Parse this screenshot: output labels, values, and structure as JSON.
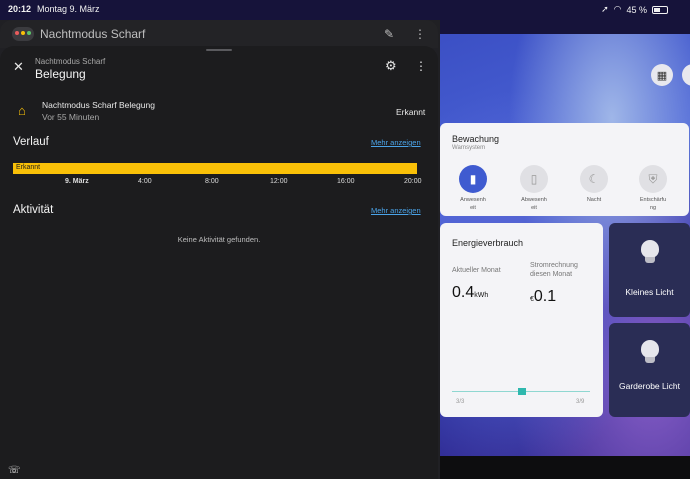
{
  "status": {
    "time": "20:12",
    "date": "Montag 9. März",
    "battery": "45 %"
  },
  "background_header": {
    "title": "Nachtmodus Scharf"
  },
  "dialog": {
    "subtitle": "Nachtmodus Scharf",
    "title": "Belegung",
    "entity": {
      "name": "Nachtmodus Scharf Belegung",
      "time": "Vor 55 Minuten",
      "state": "Erkannt"
    },
    "history": {
      "title": "Verlauf",
      "more": "Mehr anzeigen",
      "bar_label": "Erkannt",
      "bar_color": "#f9c008",
      "ticks": [
        "9. März",
        "4:00",
        "8:00",
        "12:00",
        "16:00",
        "20:00"
      ]
    },
    "activity": {
      "title": "Aktivität",
      "more": "Mehr anzeigen",
      "empty": "Keine Aktivität gefunden."
    }
  },
  "dashboard": {
    "bewachung": {
      "title": "Bewachung",
      "subtitle": "Warnsystem",
      "modes": [
        {
          "label": "Anwesenh eit",
          "icon": "door-icon",
          "active": true
        },
        {
          "label": "Abwesenh eit",
          "icon": "door-walk-icon",
          "active": false
        },
        {
          "label": "Nacht",
          "icon": "moon-icon",
          "active": false
        },
        {
          "label": "Entschärfu ng",
          "icon": "shield-off-icon",
          "active": false
        }
      ]
    },
    "energy": {
      "title": "Energieverbrauch",
      "current_label": "Aktueller Monat",
      "current_value": "0.4",
      "current_unit": "kWh",
      "bill_label": "Stromrechnung diesen Monat",
      "bill_currency": "€",
      "bill_value": "0.1",
      "range_start": "3/3",
      "range_end": "3/9"
    },
    "lights": [
      {
        "label": "Kleines Licht"
      },
      {
        "label": "Garderobe Licht"
      }
    ]
  },
  "colors": {
    "accent": "#3f5bd0",
    "link": "#4aa3e8",
    "warning": "#f9c008"
  }
}
